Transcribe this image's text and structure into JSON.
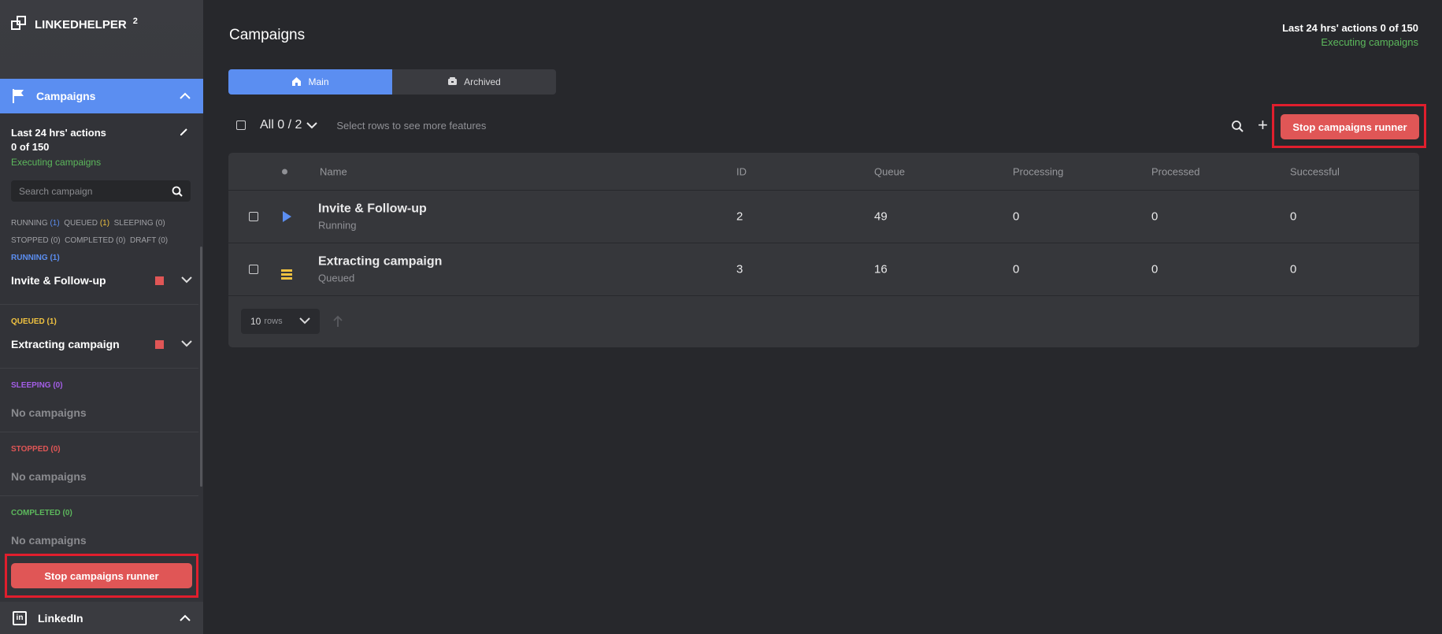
{
  "app": {
    "logo_text": "LINKEDHELPER",
    "logo_sup": "2"
  },
  "sidebar": {
    "section_title": "Campaigns",
    "stats_label": "Last 24 hrs' actions",
    "stats_value": "0 of 150",
    "status_text": "Executing campaigns",
    "search_placeholder": "Search campaign",
    "counts": {
      "running_label": "RUNNING",
      "running_count": "(1)",
      "queued_label": "QUEUED",
      "queued_count": "(1)",
      "sleeping": "SLEEPING (0)",
      "stopped": "STOPPED (0)",
      "completed": "COMPLETED (0)",
      "draft": "DRAFT (0)"
    },
    "groups": [
      {
        "label": "RUNNING (1)",
        "color": "#5b8ef1",
        "item": "Invite & Follow-up"
      },
      {
        "label": "QUEUED (1)",
        "color": "#f0c240",
        "item": "Extracting campaign"
      },
      {
        "label": "SLEEPING (0)",
        "color": "#a45ee8",
        "empty": "No campaigns"
      },
      {
        "label": "STOPPED (0)",
        "color": "#e05656",
        "empty": "No campaigns"
      },
      {
        "label": "COMPLETED (0)",
        "color": "#5cb85c",
        "empty": "No campaigns"
      }
    ],
    "stop_button": "Stop campaigns runner",
    "linkedin_label": "LinkedIn"
  },
  "main": {
    "title": "Campaigns",
    "top_right_line1": "Last 24 hrs' actions 0 of 150",
    "top_right_line2": "Executing campaigns",
    "tabs": [
      {
        "label": "Main",
        "active": true
      },
      {
        "label": "Archived",
        "active": false
      }
    ],
    "select_all": "All 0 / 2",
    "hint": "Select rows to see more features",
    "stop_button": "Stop campaigns runner",
    "table": {
      "columns": [
        "Name",
        "ID",
        "Queue",
        "Processing",
        "Processed",
        "Successful"
      ],
      "rows": [
        {
          "name": "Invite & Follow-up",
          "status": "Running",
          "id": "2",
          "queue": "49",
          "processing": "0",
          "processed": "0",
          "successful": "0"
        },
        {
          "name": "Extracting campaign",
          "status": "Queued",
          "id": "3",
          "queue": "16",
          "processing": "0",
          "processed": "0",
          "successful": "0"
        }
      ]
    },
    "rows_per_page": "10",
    "rows_unit": "rows"
  },
  "colors": {
    "accent": "#5b8ef1",
    "stop": "#e05656",
    "success": "#5cb85c",
    "queued": "#f0c240"
  }
}
